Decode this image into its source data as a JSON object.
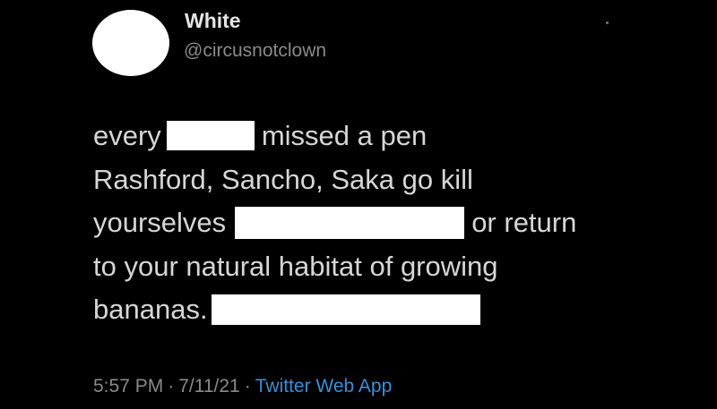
{
  "user": {
    "display_name": "White",
    "handle": "@circusnotclown"
  },
  "tweet": {
    "line1_a": "every",
    "line1_b": "missed a pen",
    "line2": "Rashford, Sancho, Saka go kill",
    "line3_a": "yourselves",
    "line3_b": "or return",
    "line4": "to your natural habitat of growing",
    "line5": "bananas."
  },
  "meta": {
    "time": "5:57 PM",
    "date": "7/11/21",
    "separator": "·",
    "source": "Twitter Web App"
  },
  "colors": {
    "background": "#000000",
    "text": "#d6d6d6",
    "muted": "#8a8a8a",
    "link": "#3a8fd6",
    "redaction": "#ffffff"
  }
}
